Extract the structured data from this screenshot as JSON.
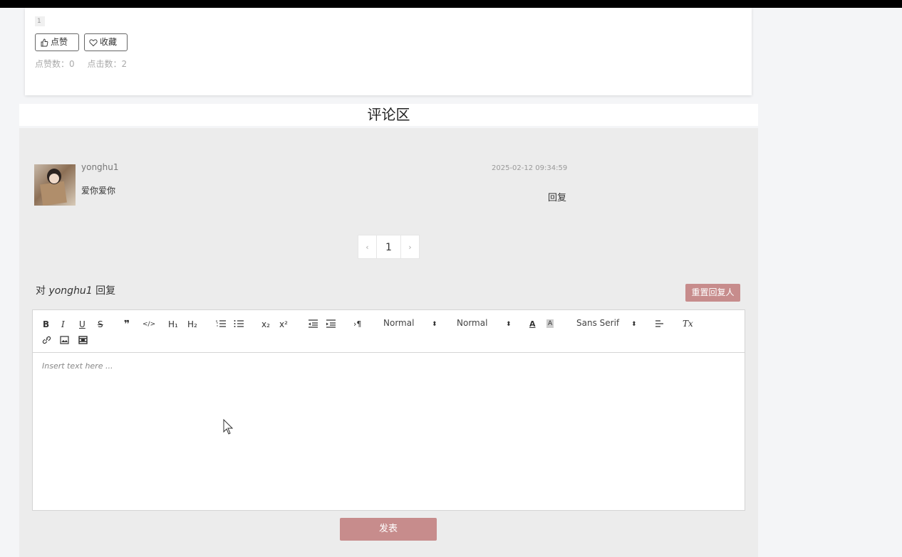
{
  "post": {
    "tag": "1",
    "like_button": "点赞",
    "favorite_button": "收藏",
    "stats": {
      "likes": "点赞数：0",
      "clicks": "点击数：2"
    }
  },
  "comments": {
    "title": "评论区",
    "items": [
      {
        "user": "yonghu1",
        "text": "爱你爱你",
        "time": "2025-02-12 09:34:59",
        "reply_label": "回复"
      }
    ],
    "pagination": {
      "prev": "‹",
      "current": "1",
      "next": "›"
    }
  },
  "reply_form": {
    "prefix": "对",
    "target_user": "yonghu1",
    "suffix": "回复",
    "reset_button": "重置回复人",
    "toolbar": {
      "bold": "B",
      "italic": "I",
      "underline": "U",
      "strike": "S",
      "blockquote": "❞",
      "code": "</>",
      "h1": "H₁",
      "h2": "H₂",
      "sub": "x₂",
      "sup": "x²",
      "direction": "›¶",
      "size_select": "Normal",
      "header_select": "Normal",
      "font_select": "Sans Serif",
      "color": "A",
      "background": "A",
      "clean": "Tx"
    },
    "placeholder": "Insert text here ...",
    "publish_button": "发表"
  },
  "colors": {
    "accent": "#c78c8c",
    "area_bg": "#ececec"
  }
}
